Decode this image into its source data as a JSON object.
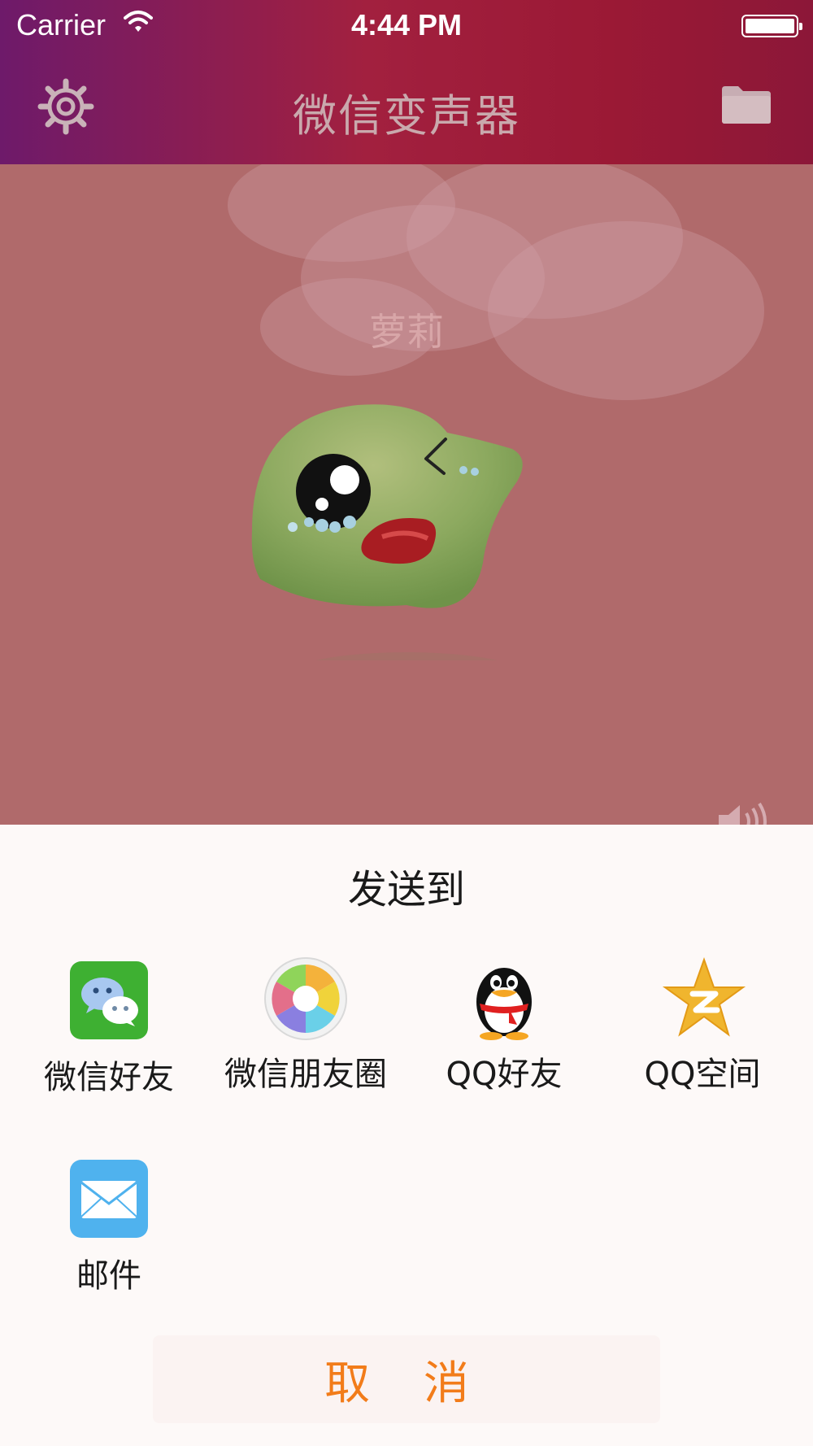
{
  "status_bar": {
    "carrier": "Carrier",
    "time": "4:44 PM"
  },
  "nav": {
    "title": "微信变声器",
    "left_icon": "gear-icon",
    "right_icon": "folder-icon"
  },
  "stage": {
    "voice_name": "萝莉",
    "character": "crying-green-blob",
    "volume_icon": "speaker-icon"
  },
  "share_sheet": {
    "title": "发送到",
    "items": [
      {
        "label": "微信好友",
        "icon": "wechat-icon"
      },
      {
        "label": "微信朋友圈",
        "icon": "moments-icon"
      },
      {
        "label": "QQ好友",
        "icon": "qq-penguin-icon"
      },
      {
        "label": "QQ空间",
        "icon": "qzone-star-icon"
      },
      {
        "label": "邮件",
        "icon": "mail-icon"
      }
    ],
    "cancel_label": "取 消"
  },
  "colors": {
    "accent": "#f27c1a",
    "header_gradient_start": "#6e1a6a",
    "header_gradient_end": "#8c1738",
    "stage_bg": "#b06a6b"
  }
}
